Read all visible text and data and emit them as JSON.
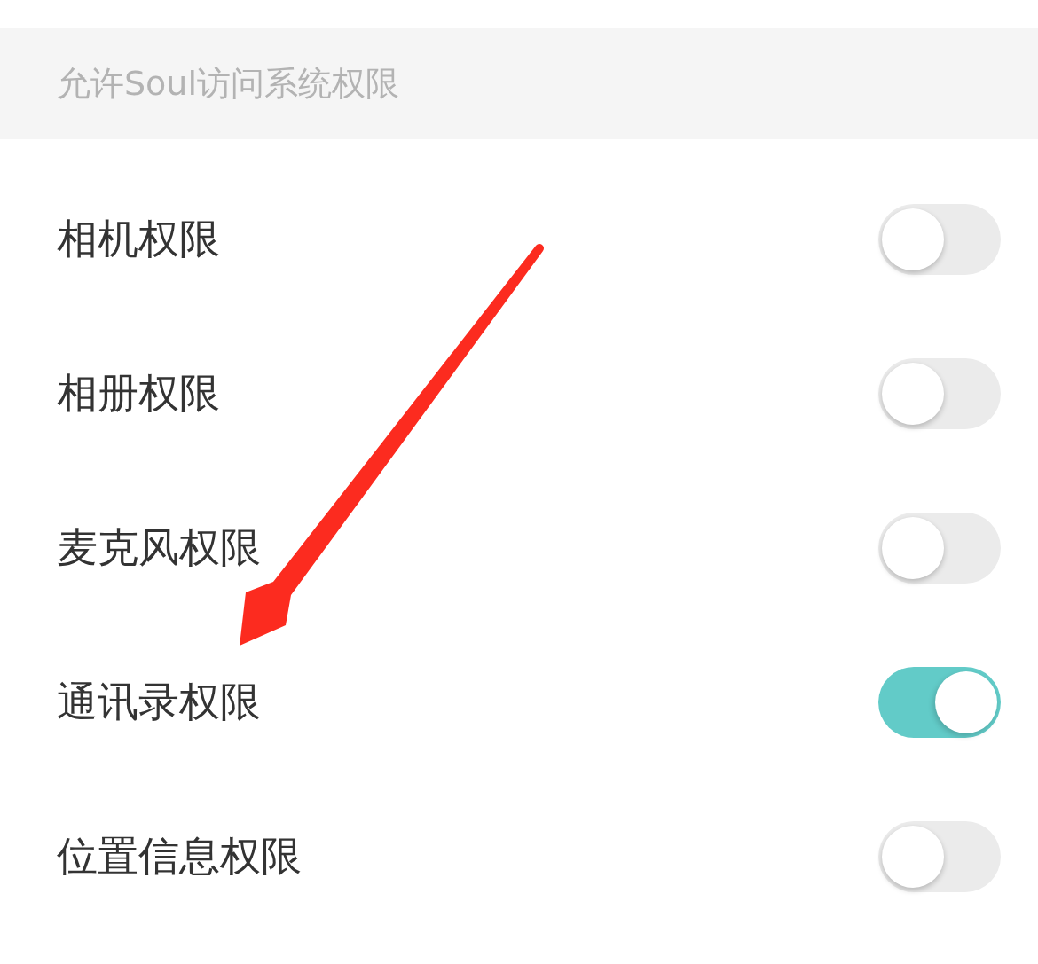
{
  "header": {
    "title": "允许Soul访问系统权限"
  },
  "permissions": [
    {
      "label": "相机权限",
      "on": false
    },
    {
      "label": "相册权限",
      "on": false
    },
    {
      "label": "麦克风权限",
      "on": false
    },
    {
      "label": "通讯录权限",
      "on": true
    },
    {
      "label": "位置信息权限",
      "on": false
    }
  ],
  "annotations": [
    {
      "kind": "arrow"
    }
  ]
}
